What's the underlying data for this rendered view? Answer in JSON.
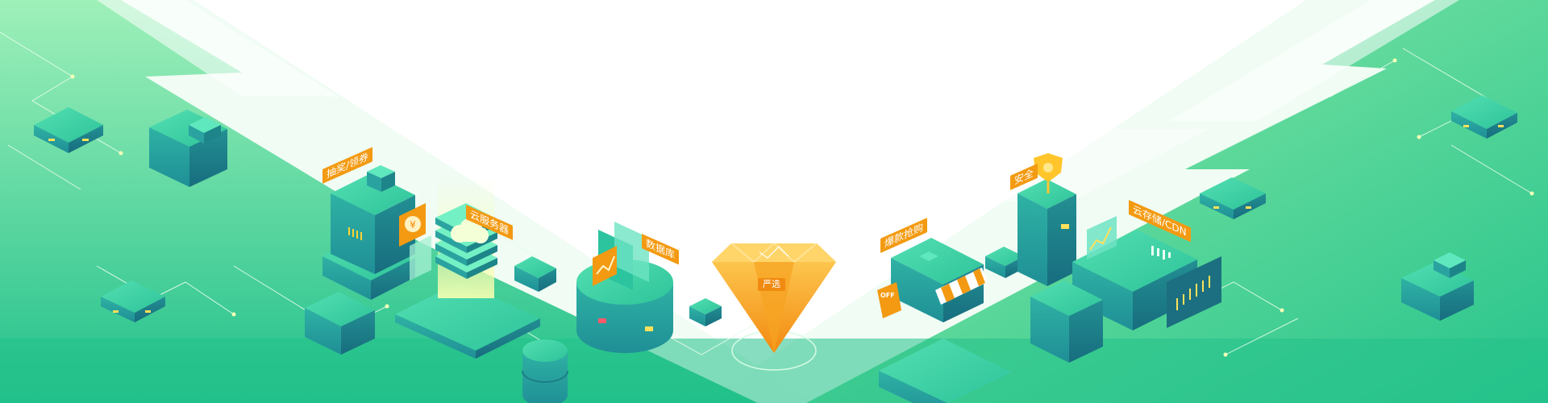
{
  "banner": {
    "colors": {
      "ground_light": "#b8f2c6",
      "ground_dark": "#1fbe86",
      "block_top": "#3fd2a6",
      "block_left": "#2aa3a0",
      "block_right": "#1d8589",
      "accent_orange": "#f39a12",
      "accent_yellow": "#ffd233",
      "circuit_line": "#d9fbe6"
    },
    "labels": {
      "lottery": "抽奖/领券",
      "cloud_server": "云服务器",
      "database": "数据库",
      "featured": "严选",
      "hot_deals": "爆款抢购",
      "security": "安全",
      "storage_cdn": "云存储/CDN",
      "off_badge": "OFF"
    },
    "icons": {
      "coupon": "yen-coupon-icon",
      "cloud": "cloud-icon",
      "chart": "line-chart-icon",
      "diamond": "diamond-icon",
      "shield": "shield-icon",
      "store": "storefront-icon",
      "monitor": "stock-chart-icon"
    }
  }
}
